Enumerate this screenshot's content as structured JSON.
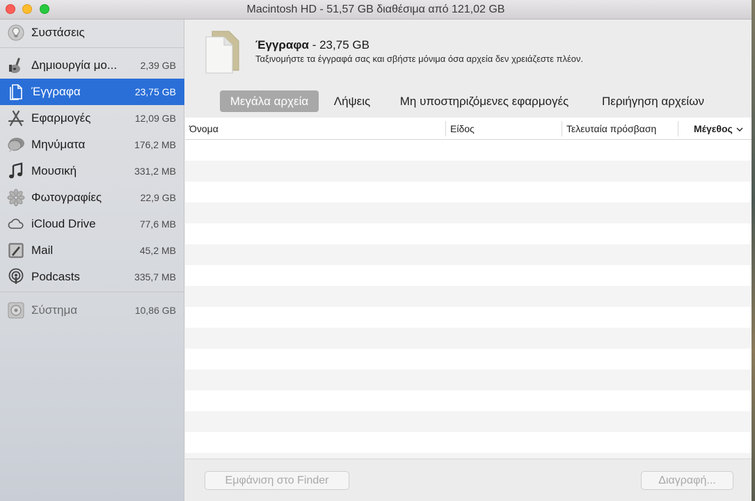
{
  "window": {
    "title": "Macintosh HD - 51,57 GB διαθέσιμα από 121,02 GB"
  },
  "sidebar": {
    "recommendations": {
      "label": "Συστάσεις",
      "icon": "lightbulb-icon"
    },
    "items": [
      {
        "label": "Δημιουργία μο...",
        "size": "2,39 GB",
        "icon": "guitar-icon"
      },
      {
        "label": "Έγγραφα",
        "size": "23,75 GB",
        "icon": "document-icon",
        "selected": true
      },
      {
        "label": "Εφαρμογές",
        "size": "12,09 GB",
        "icon": "app-store-icon"
      },
      {
        "label": "Μηνύματα",
        "size": "176,2 MB",
        "icon": "messages-icon"
      },
      {
        "label": "Μουσική",
        "size": "331,2 MB",
        "icon": "music-note-icon"
      },
      {
        "label": "Φωτογραφίες",
        "size": "22,9 GB",
        "icon": "photos-icon"
      },
      {
        "label": "iCloud Drive",
        "size": "77,6 MB",
        "icon": "cloud-icon"
      },
      {
        "label": "Mail",
        "size": "45,2 MB",
        "icon": "mail-icon"
      },
      {
        "label": "Podcasts",
        "size": "335,7 MB",
        "icon": "podcasts-icon"
      }
    ],
    "system": {
      "label": "Σύστημα",
      "size": "10,86 GB",
      "icon": "system-disk-icon"
    }
  },
  "header": {
    "title": "Έγγραφα",
    "size": " - 23,75 GB",
    "description": "Ταξινομήστε τα έγγραφά σας και σβήστε μόνιμα όσα αρχεία δεν χρειάζεστε πλέον."
  },
  "tabs": [
    {
      "label": "Μεγάλα αρχεία",
      "active": true
    },
    {
      "label": "Λήψεις"
    },
    {
      "label": "Μη υποστηριζόμενες εφαρμογές"
    },
    {
      "label": "Περιήγηση αρχείων"
    }
  ],
  "table": {
    "columns": [
      "Όνομα",
      "Είδος",
      "Τελευταία πρόσβαση",
      "Μέγεθος"
    ],
    "sorted_column": "Μέγεθος",
    "rows": []
  },
  "footer": {
    "show_in_finder": "Εμφάνιση στο Finder",
    "delete": "Διαγραφή..."
  },
  "colors": {
    "selection": "#2a6fd8",
    "active_tab": "#a8a8a8"
  }
}
